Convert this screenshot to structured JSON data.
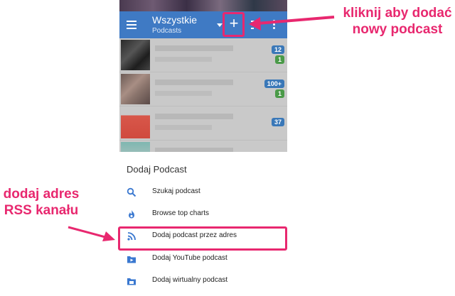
{
  "appbar": {
    "title": "Wszystkie",
    "subtitle": "Podcasts",
    "add_symbol": "+"
  },
  "list": {
    "rows": [
      {
        "badges": [
          "12",
          "1"
        ]
      },
      {
        "badges": [
          "100+",
          "1"
        ]
      },
      {
        "badges": [
          "37"
        ]
      },
      {
        "badges": []
      }
    ]
  },
  "sheet": {
    "title": "Dodaj Podcast",
    "items": [
      {
        "label": "Szukaj podcast",
        "icon": "search-icon"
      },
      {
        "label": "Browse top charts",
        "icon": "flame-icon"
      },
      {
        "label": "Dodaj podcast przez adres",
        "icon": "rss-icon"
      },
      {
        "label": "Dodaj YouTube podcast",
        "icon": "youtube-folder-icon"
      },
      {
        "label": "Dodaj wirtualny podcast",
        "icon": "virtual-folder-icon"
      }
    ]
  },
  "annotations": {
    "top_right_line1": "kliknij aby dodać",
    "top_right_line2": "nowy podcast",
    "left_line1": "dodaj adres",
    "left_line2": "RSS kanału"
  },
  "colors": {
    "accent": "#3f7ac4",
    "annotation": "#e8286f",
    "icon": "#3a78d0"
  }
}
